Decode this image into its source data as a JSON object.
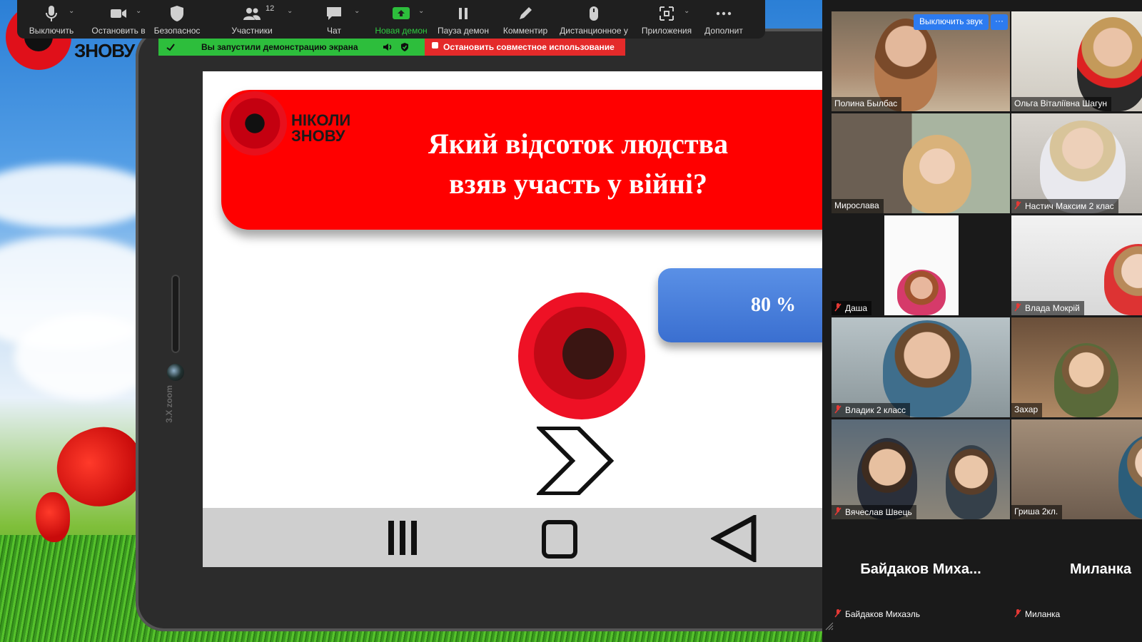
{
  "toolbar": {
    "items": [
      {
        "label": "Выключить",
        "icon": "microphone-icon"
      },
      {
        "label": "Остановить в",
        "icon": "video-camera-icon"
      },
      {
        "label": "Безопаснос",
        "icon": "shield-icon"
      },
      {
        "label": "Участники",
        "icon": "participants-icon",
        "count": "12"
      },
      {
        "label": "Чат",
        "icon": "chat-icon"
      },
      {
        "label": "Новая демон",
        "icon": "share-screen-icon"
      },
      {
        "label": "Пауза демон",
        "icon": "pause-icon"
      },
      {
        "label": "Комментир",
        "icon": "pencil-icon"
      },
      {
        "label": "Дистанционное у",
        "icon": "mouse-icon"
      },
      {
        "label": "Приложения",
        "icon": "apps-icon"
      },
      {
        "label": "Дополнит",
        "icon": "more-icon"
      }
    ]
  },
  "share_bar": {
    "status": "Вы запустили демонстрацию экрана",
    "stop": "Остановить совместное использование"
  },
  "wallpaper": {
    "logo_text": "ЗНОВУ"
  },
  "slide": {
    "logo_line1": "НІКОЛИ",
    "logo_line2": "ЗНОВУ",
    "title_line1": "Який відсоток людства",
    "title_line2": "взяв участь у війні?",
    "answer": "80 %"
  },
  "tablet": {
    "brand": "3.X zoom"
  },
  "gallery": {
    "unmute_label": "Выключить звук",
    "more_label": "···",
    "tiles": [
      {
        "name": "Полина Былбас",
        "muted": false
      },
      {
        "name": "Ольга Віталіївна Шагун",
        "muted": false
      },
      {
        "name": "Мирослава",
        "muted": false
      },
      {
        "name": "Настич Максим 2 клас",
        "muted": true
      },
      {
        "name": "Даша",
        "muted": true
      },
      {
        "name": "Влада Мокрій",
        "muted": true
      },
      {
        "name": "Владик 2 класс",
        "muted": true
      },
      {
        "name": "Захар",
        "muted": false
      },
      {
        "name": "Вячеслав Швець",
        "muted": true
      },
      {
        "name": "Гриша 2кл.",
        "muted": false
      },
      {
        "name": "Байдаков Михаэль",
        "muted": true,
        "big_name": "Байдаков  Миха..."
      },
      {
        "name": "Миланка",
        "muted": true,
        "big_name": "Миланка"
      }
    ]
  },
  "colors": {
    "zoom_green": "#2dbe3c",
    "zoom_red": "#e42a2a",
    "slide_red": "#ff0000",
    "answer_blue": "#4a80de",
    "active_speaker": "#e0e35a"
  }
}
